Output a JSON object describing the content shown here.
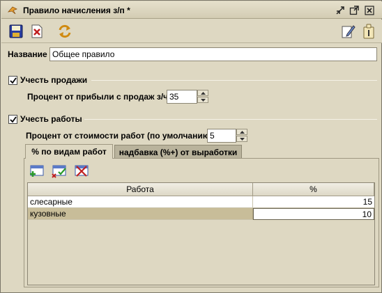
{
  "window": {
    "title": "Правило начисления з/п *"
  },
  "toolbar": {
    "save": "save-icon",
    "close": "close-doc-icon",
    "refresh": "refresh-icon",
    "edit": "edit-icon",
    "info": "info-icon"
  },
  "form": {
    "name_label": "Название",
    "name_value": "Общее правило",
    "sales": {
      "checkbox_label": "Учесть продажи",
      "checked": true,
      "percent_label": "Процент от прибыли с продаж з/ч",
      "percent_value": "35"
    },
    "works": {
      "checkbox_label": "Учесть работы",
      "checked": true,
      "percent_label": "Процент от стоимости работ (по умолчанию)",
      "percent_value": "5"
    }
  },
  "tabs": [
    {
      "label": "% по видам работ",
      "active": true
    },
    {
      "label": "надбавка (%+) от выработки",
      "active": false
    }
  ],
  "table": {
    "columns": [
      "Работа",
      "%"
    ],
    "rows": [
      {
        "work": "слесарные",
        "percent": "15",
        "selected": false
      },
      {
        "work": "кузовные",
        "percent": "10",
        "selected": true
      }
    ]
  },
  "colors": {
    "window_bg": "#ded8c2",
    "selected_row": "#c8bd99",
    "accent_red": "#c02020",
    "accent_green": "#2a9a2a"
  }
}
